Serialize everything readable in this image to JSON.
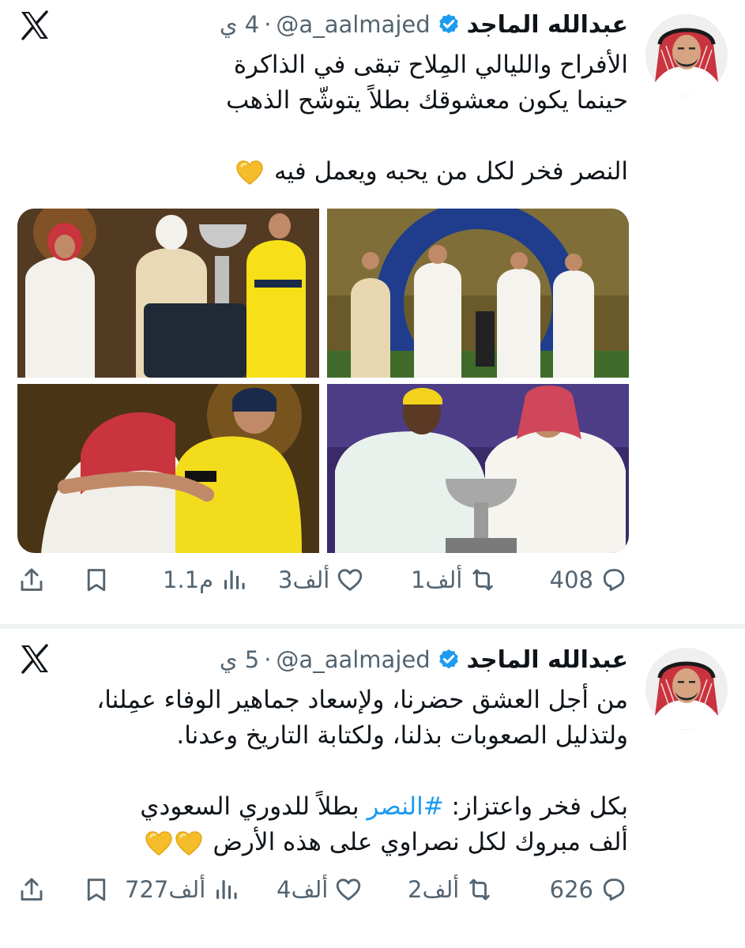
{
  "tweets": [
    {
      "author_name": "عبدالله الماجد",
      "handle": "@a_aalmajed",
      "time": "4 ي",
      "lines": [
        "الأفراح والليالي المِلاح تبقى في الذاكرة",
        "حينما يكون معشوقك بطلاً يتوشّح الذهب",
        "",
        "النصر فخر لكل من يحبه ويعمل فيه"
      ],
      "stats": {
        "replies": "408",
        "reposts": "1ألف",
        "likes": "3ألف",
        "views": "1.1م"
      }
    },
    {
      "author_name": "عبدالله الماجد",
      "handle": "@a_aalmajed",
      "time": "5 ي",
      "lines": [
        "من أجل العشق حضرنا، ولإسعاد جماهير الوفاء عمِلنا،",
        "ولتذليل الصعوبات بذلنا، ولكتابة التاريخ وعدنا.",
        ""
      ],
      "line4_pre": "بكل فخر واعتزاز: ",
      "hashtag": "#النصر",
      "line4_post": " بطلاً للدوري السعودي",
      "line5": "ألف مبروك لكل نصراوي على هذه الأرض",
      "stats": {
        "replies": "626",
        "reposts": "2ألف",
        "likes": "4ألف",
        "views": "727ألف"
      }
    }
  ],
  "icons": {
    "x_logo": "x-logo-icon",
    "verified": "verified-badge-icon",
    "reply": "reply-icon",
    "repost": "repost-icon",
    "like": "heart-icon",
    "views": "views-icon",
    "bookmark": "bookmark-icon",
    "share": "share-icon",
    "yellow_heart": "yellow-heart-emoji"
  },
  "colors": {
    "text": "#0f1419",
    "muted": "#536471",
    "link": "#1d9bf0",
    "verified": "#1d9bf0",
    "divider": "#eff3f4"
  }
}
